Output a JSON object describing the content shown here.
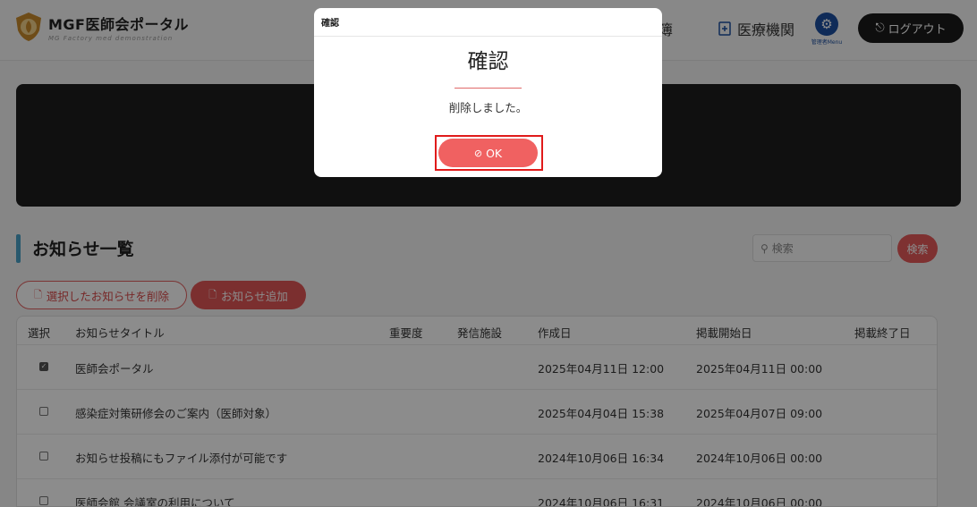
{
  "header": {
    "logo_title": "MGF医師会ポータル",
    "logo_subtitle": "MG Factory med demonstration",
    "nav_partial_label": "簿",
    "nav_medical_label": "医療機関",
    "admin_menu_label": "管理者Menu",
    "logout_label": "ログアウト"
  },
  "section": {
    "title": "お知らせ一覧",
    "search_placeholder": "検索",
    "search_button": "検索",
    "delete_button": "選択したお知らせを削除",
    "add_button": "お知らせ追加"
  },
  "table": {
    "columns": [
      "選択",
      "お知らせタイトル",
      "重要度",
      "発信施設",
      "作成日",
      "掲載開始日",
      "掲載終了日"
    ],
    "rows": [
      {
        "checked": true,
        "title": "医師会ポータル",
        "importance": "",
        "facility": "",
        "created": "2025年04月11日 12:00",
        "start": "2025年04月11日 00:00",
        "end": ""
      },
      {
        "checked": false,
        "title": "感染症対策研修会のご案内（医師対象）",
        "importance": "",
        "facility": "",
        "created": "2025年04月04日 15:38",
        "start": "2025年04月07日 09:00",
        "end": ""
      },
      {
        "checked": false,
        "title": "お知らせ投稿にもファイル添付が可能です",
        "importance": "",
        "facility": "",
        "created": "2024年10月06日 16:34",
        "start": "2024年10月06日 00:00",
        "end": ""
      },
      {
        "checked": false,
        "title": "医師会館 会議室の利用について",
        "importance": "",
        "facility": "",
        "created": "2024年10月06日 16:31",
        "start": "2024年10月06日 00:00",
        "end": ""
      }
    ]
  },
  "modal": {
    "header": "確認",
    "title": "確認",
    "message": "削除しました。",
    "ok_label": "OK"
  },
  "colors": {
    "accent_red": "#e05656",
    "ok_button": "#f06161",
    "highlight_frame": "#e01b1b",
    "admin_blue": "#1c4fa0",
    "section_bar": "#4aa0c6"
  }
}
